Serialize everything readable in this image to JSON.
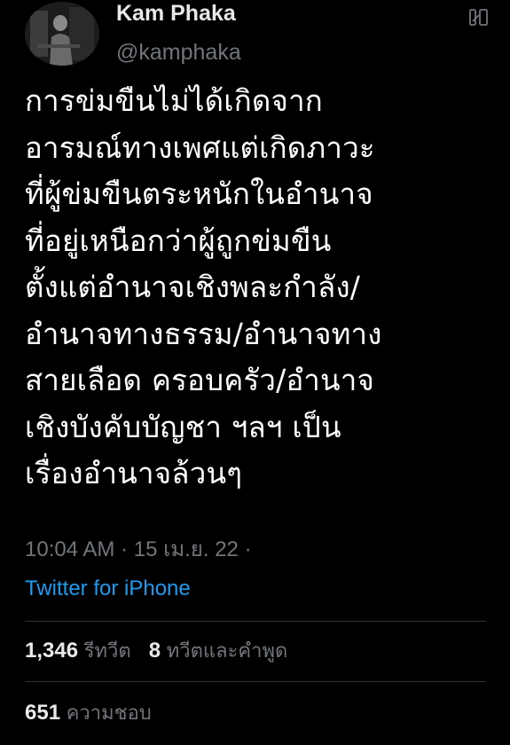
{
  "author": {
    "display_name": "Kam Phaka",
    "handle": "@kamphaka",
    "avatar_icon": "profile-photo"
  },
  "more_icon": "more-options-icon",
  "tweet": {
    "lines": [
      "การข่มขืนไม่ได้เกิดจาก",
      "อารมณ์ทางเพศแต่เกิดภาวะ",
      "ที่ผู้ข่มขืนตระหนักในอำนาจ",
      "ที่อยู่เหนือกว่าผู้ถูกข่มขืน",
      "ตั้งแต่อำนาจเชิงพละกำลัง/",
      "อำนาจทางธรรม/อำนาจทาง",
      "สายเลือด ครอบครัว/อำนาจ",
      "เชิงบังคับบัญชา ฯลฯ เป็น",
      "เรื่องอำนาจล้วนๆ"
    ]
  },
  "meta": {
    "time": "10:04 AM",
    "date": "15 เม.ย. 22",
    "separator": "·"
  },
  "source": "Twitter for iPhone",
  "stats": {
    "retweets_count": "1,346",
    "retweets_label": "รีทวีต",
    "quotes_count": "8",
    "quotes_label": "ทวีตและคำพูด",
    "likes_count": "651",
    "likes_label": "ความชอบ"
  },
  "colors": {
    "background": "#000000",
    "primary_text": "#e7e9ea",
    "secondary_text": "#71767b",
    "link": "#1d9bf0",
    "divider": "#2f3336"
  }
}
